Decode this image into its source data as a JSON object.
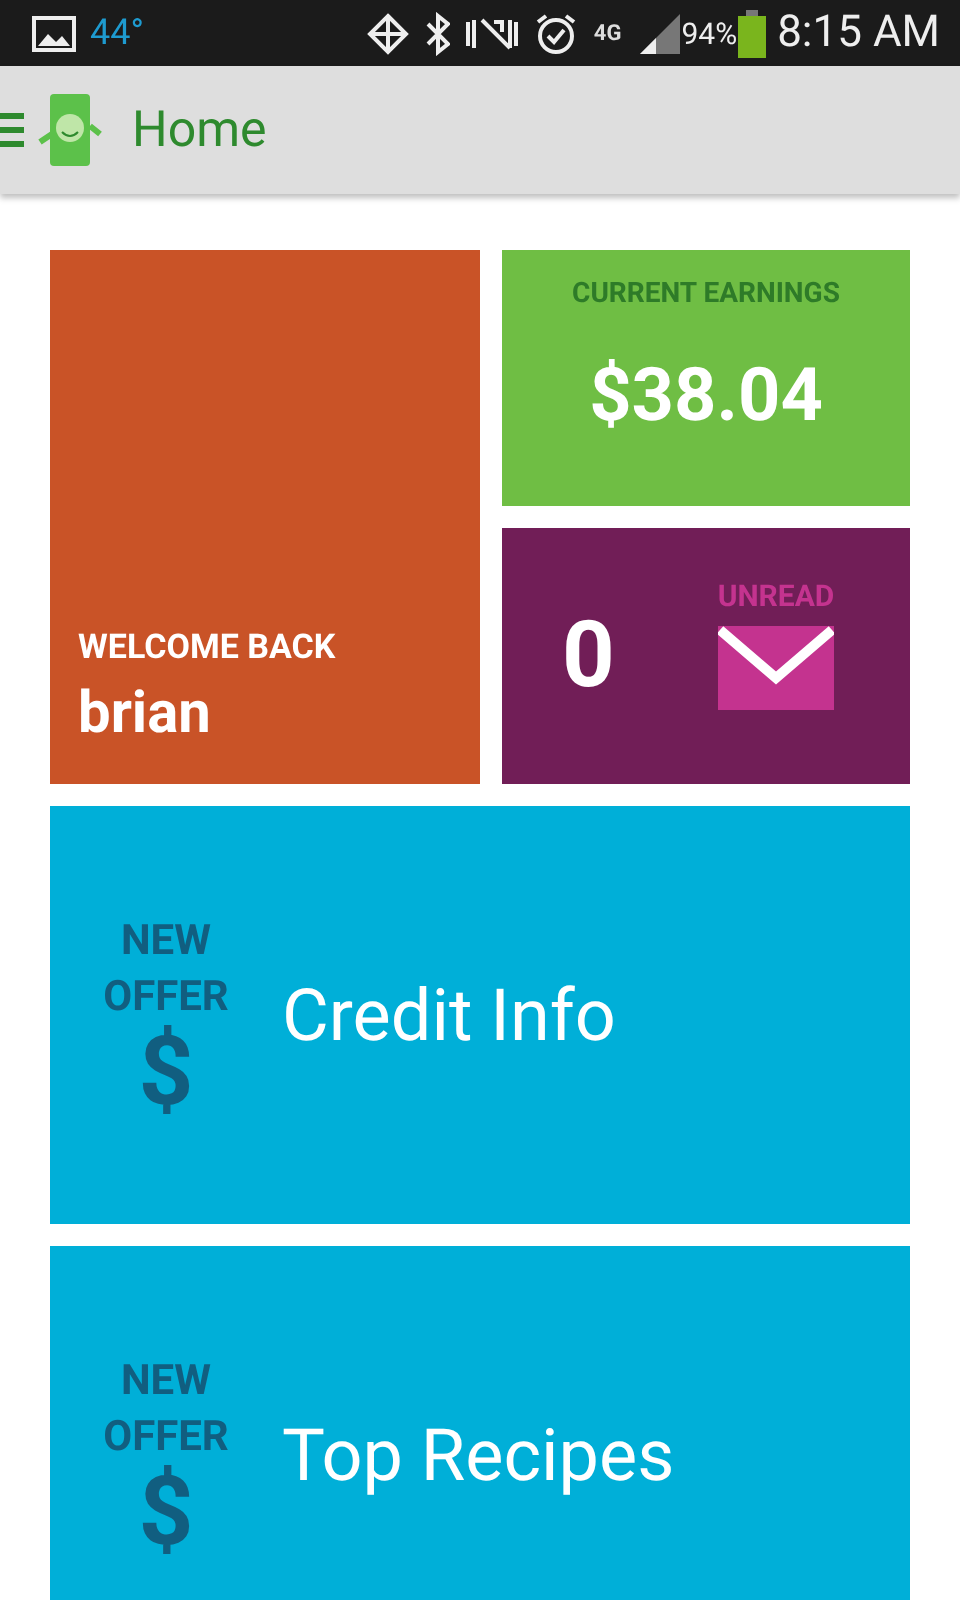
{
  "status_bar": {
    "temperature": "44°",
    "network_type": "4G",
    "battery": "94%",
    "time": "8:15 AM"
  },
  "app_bar": {
    "title": "Home"
  },
  "welcome": {
    "label": "WELCOME BACK",
    "name": "brian"
  },
  "earnings": {
    "label": "CURRENT EARNINGS",
    "amount": "$38.04"
  },
  "messages": {
    "count": "0",
    "label": "UNREAD"
  },
  "offers": [
    {
      "badge": "NEW OFFER",
      "symbol": "$",
      "title": "Credit Info"
    },
    {
      "badge": "NEW OFFER",
      "symbol": "$",
      "title": "Top Recipes"
    }
  ]
}
